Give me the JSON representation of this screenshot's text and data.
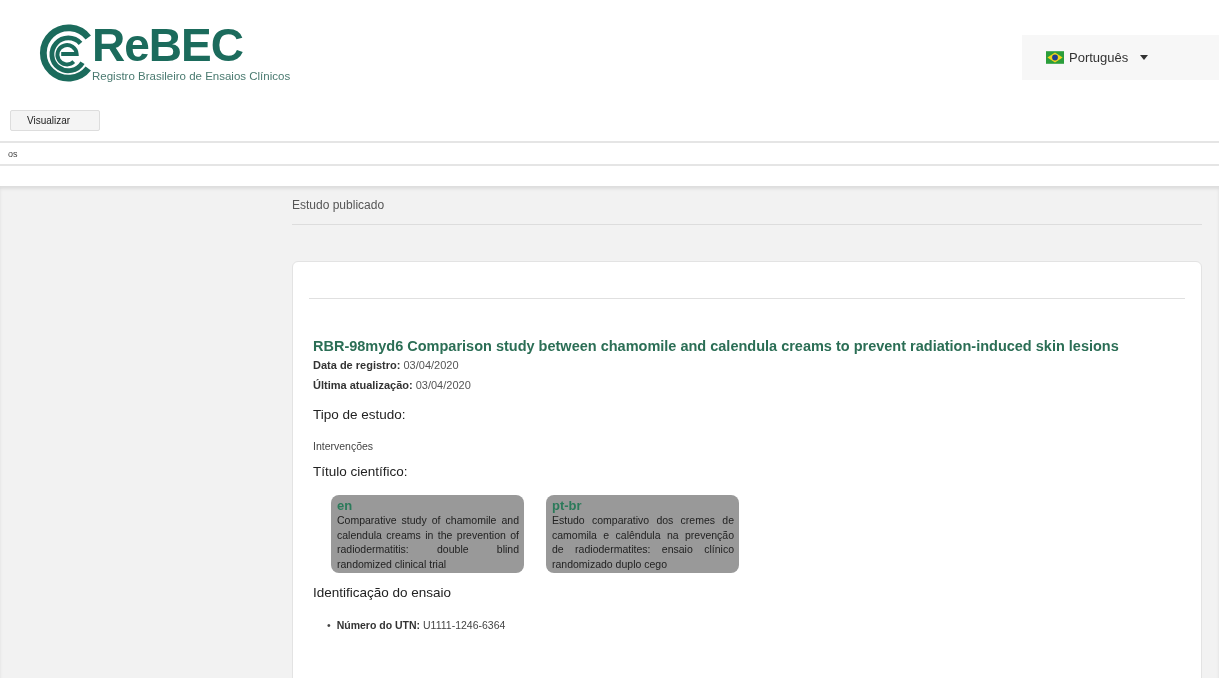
{
  "header": {
    "logo": {
      "name": "ReBEC",
      "subtitle": "Registro Brasileiro de Ensaios Clínicos"
    },
    "language": {
      "label": "Português"
    }
  },
  "breadcrumb": {
    "button": "Visualizar",
    "crumb": "os"
  },
  "page_title": "Estudo publicado",
  "study": {
    "title": "RBR-98myd6 Comparison study between chamomile and calendula creams to prevent radiation-induced skin lesions",
    "meta": [
      "**Data de registro:** 03/04/2020",
      "**Última atualização:** 03/04/2020"
    ],
    "study_type": {
      "heading": "Tipo de estudo:",
      "value": "Intervenções"
    },
    "scientific_title": {
      "heading": "Título científico:",
      "translations": [
        {
          "lang": "en",
          "text": "Comparative study of chamomile and calendula creams in the prevention of radiodermatitis: double blind randomized clinical trial"
        },
        {
          "lang": "pt-br",
          "text": "Estudo comparativo dos cremes de camomila e calêndula na prevenção de radiodermatites: ensaio clínico randomizado duplo cego"
        }
      ]
    },
    "identification": {
      "heading": "Identificação do ensaio",
      "items": [
        {
          "bullet": "•",
          "text": "**Número do UTN:** U1111-1246-6364"
        }
      ]
    }
  }
}
